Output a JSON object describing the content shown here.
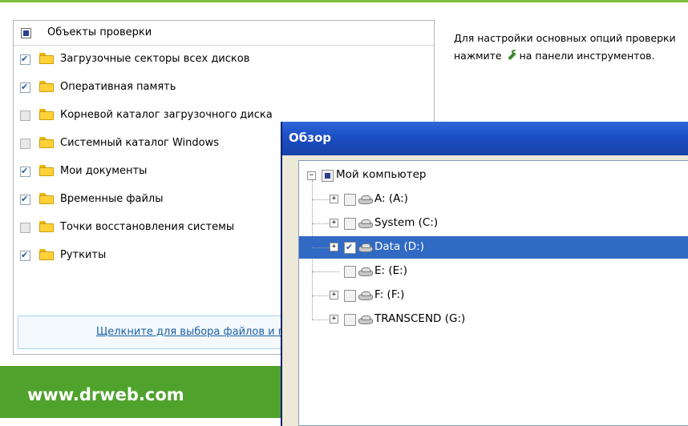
{
  "panel": {
    "header": "Объекты проверки",
    "items": [
      {
        "label": "Загрузочные секторы всех дисков",
        "checked": true
      },
      {
        "label": "Оперативная память",
        "checked": true
      },
      {
        "label": "Корневой каталог загрузочного диска",
        "checked": false
      },
      {
        "label": "Системный каталог Windows",
        "checked": false
      },
      {
        "label": "Мои документы",
        "checked": true
      },
      {
        "label": "Временные файлы",
        "checked": true
      },
      {
        "label": "Точки восстановления системы",
        "checked": false
      },
      {
        "label": "Руткиты",
        "checked": true
      }
    ],
    "select_link": "Щелкните для выбора файлов и папок"
  },
  "tip": {
    "part1": "Для настройки основных опций проверки нажмите",
    "icon": "wrench-icon",
    "part2": "на панели инструментов."
  },
  "footer": {
    "url": "www.drweb.com"
  },
  "dialog": {
    "title": "Обзор",
    "root": "Мой компьютер",
    "drives": [
      {
        "label": "A: (A:)",
        "icon": "floppy-drive-icon",
        "checked": false,
        "selected": false,
        "expandable": true
      },
      {
        "label": "System (C:)",
        "icon": "hard-drive-icon",
        "checked": false,
        "selected": false,
        "expandable": true
      },
      {
        "label": "Data (D:)",
        "icon": "hard-drive-icon",
        "checked": true,
        "selected": true,
        "expandable": true
      },
      {
        "label": "E: (E:)",
        "icon": "cd-drive-icon",
        "checked": false,
        "selected": false,
        "expandable": false
      },
      {
        "label": "F: (F:)",
        "icon": "removable-drive-icon",
        "checked": false,
        "selected": false,
        "expandable": true
      },
      {
        "label": "TRANSCEND (G:)",
        "icon": "removable-drive-icon",
        "checked": false,
        "selected": false,
        "expandable": true
      }
    ]
  },
  "colors": {
    "accent_green": "#4fa32c",
    "title_blue": "#1c4ec4",
    "selection": "#316ac5",
    "link": "#1a5fa8"
  }
}
